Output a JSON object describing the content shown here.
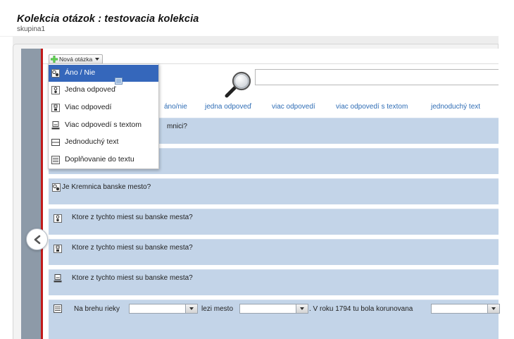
{
  "header": {
    "title": "Kolekcia otázok : testovacia kolekcia",
    "subtitle": "skupina1"
  },
  "toolbar": {
    "new_question_label": "Nová otázka"
  },
  "menu": {
    "items": [
      {
        "label": "Áno / Nie",
        "icon": "yes-no-icon",
        "selected": true
      },
      {
        "label": "Jedna odpoveď",
        "icon": "single-choice-icon"
      },
      {
        "label": "Viac odpovedí",
        "icon": "multiple-choice-icon"
      },
      {
        "label": "Viac odpovedí s textom",
        "icon": "multiple-text-icon"
      },
      {
        "label": "Jednoduchý text",
        "icon": "simple-text-icon"
      },
      {
        "label": "Doplňovanie do textu",
        "icon": "fill-in-text-icon"
      }
    ]
  },
  "search": {
    "value": "",
    "placeholder": ""
  },
  "filters": {
    "tabs": [
      {
        "label": "áno/nie"
      },
      {
        "label": "jedna odpoveď"
      },
      {
        "label": "viac odpovedí"
      },
      {
        "label": "viac odpovedí s textom"
      },
      {
        "label": "jednoduchý text"
      }
    ]
  },
  "questions": {
    "rows": [
      {
        "text": "mnici?",
        "icon": ""
      },
      {
        "text": "",
        "icon": ""
      },
      {
        "text": "Je Kremnica banske mesto?",
        "icon": "yes-no-icon"
      },
      {
        "text": "Ktore z tychto miest su banske mesta?",
        "icon": "single-choice-icon"
      },
      {
        "text": "Ktore z tychto miest su banske mesta?",
        "icon": "multiple-choice-icon"
      },
      {
        "text": "Ktore z tychto miest su banske mesta?",
        "icon": "multiple-text-icon"
      }
    ],
    "fill": {
      "icon": "fill-in-text-icon",
      "part1": "Na brehu rieky",
      "part2": "lezi mesto",
      "part3": ". V roku 1794 tu bola korunovana"
    }
  },
  "colors": {
    "accent": "#3567bb",
    "row_bg": "#c3d4e8",
    "link": "#2f6db5",
    "side_red": "#c21a1a"
  }
}
